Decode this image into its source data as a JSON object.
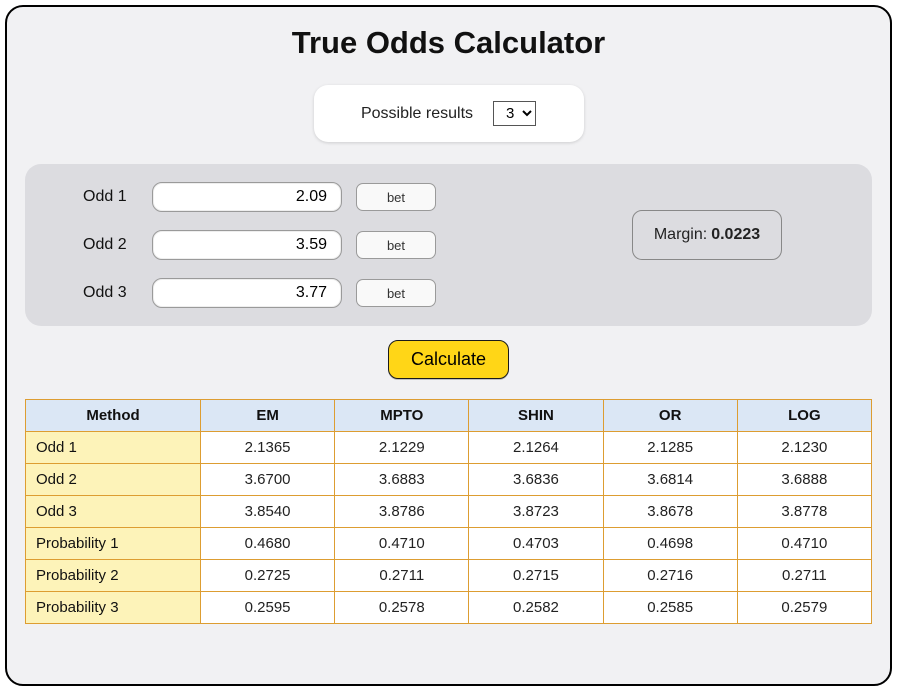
{
  "title": "True Odds Calculator",
  "possible": {
    "label": "Possible results",
    "value": "3"
  },
  "odds": {
    "rows": [
      {
        "label": "Odd 1",
        "value": "2.09",
        "bet": "bet"
      },
      {
        "label": "Odd 2",
        "value": "3.59",
        "bet": "bet"
      },
      {
        "label": "Odd 3",
        "value": "3.77",
        "bet": "bet"
      }
    ]
  },
  "margin": {
    "label": "Margin:",
    "value": "0.0223"
  },
  "calculate_label": "Calculate",
  "table": {
    "headers": [
      "Method",
      "EM",
      "MPTO",
      "SHIN",
      "OR",
      "LOG"
    ],
    "rows": [
      {
        "label": "Odd 1",
        "cells": [
          "2.1365",
          "2.1229",
          "2.1264",
          "2.1285",
          "2.1230"
        ]
      },
      {
        "label": "Odd 2",
        "cells": [
          "3.6700",
          "3.6883",
          "3.6836",
          "3.6814",
          "3.6888"
        ]
      },
      {
        "label": "Odd 3",
        "cells": [
          "3.8540",
          "3.8786",
          "3.8723",
          "3.8678",
          "3.8778"
        ]
      },
      {
        "label": "Probability 1",
        "cells": [
          "0.4680",
          "0.4710",
          "0.4703",
          "0.4698",
          "0.4710"
        ]
      },
      {
        "label": "Probability 2",
        "cells": [
          "0.2725",
          "0.2711",
          "0.2715",
          "0.2716",
          "0.2711"
        ]
      },
      {
        "label": "Probability 3",
        "cells": [
          "0.2595",
          "0.2578",
          "0.2582",
          "0.2585",
          "0.2579"
        ]
      }
    ]
  }
}
